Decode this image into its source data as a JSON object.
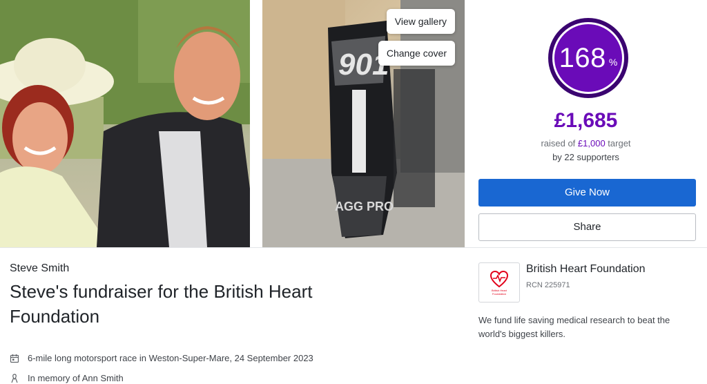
{
  "gallery": {
    "view_gallery_label": "View gallery",
    "change_cover_label": "Change cover"
  },
  "progress": {
    "percent_value": "168",
    "percent_sign": "%",
    "raised_amount": "£1,685",
    "raised_prefix": "raised of ",
    "target_amount": "£1,000",
    "target_suffix": " target",
    "supporters_prefix": "by ",
    "supporters_count": "22",
    "supporters_suffix": " supporters",
    "fraction_of_target": 1.685
  },
  "actions": {
    "give_label": "Give Now",
    "share_label": "Share"
  },
  "fundraiser": {
    "owner": "Steve Smith",
    "title": "Steve's fundraiser for the British Heart Foundation",
    "event": "6-mile long motorsport race in Weston-Super-Mare, 24 September 2023",
    "memory": "In memory of Ann Smith"
  },
  "charity": {
    "name": "British Heart Foundation",
    "rcn": "RCN 225971",
    "description": "We fund life saving medical research to beat the world's biggest killers.",
    "logo_text": "British Heart Foundation"
  },
  "colors": {
    "accent_purple": "#6a0bb8",
    "primary_blue": "#1967d2",
    "bhf_red": "#e2001a"
  },
  "icons": {
    "event": "calendar-icon",
    "memory": "ribbon-icon",
    "charity_logo": "heart-logo-icon"
  }
}
